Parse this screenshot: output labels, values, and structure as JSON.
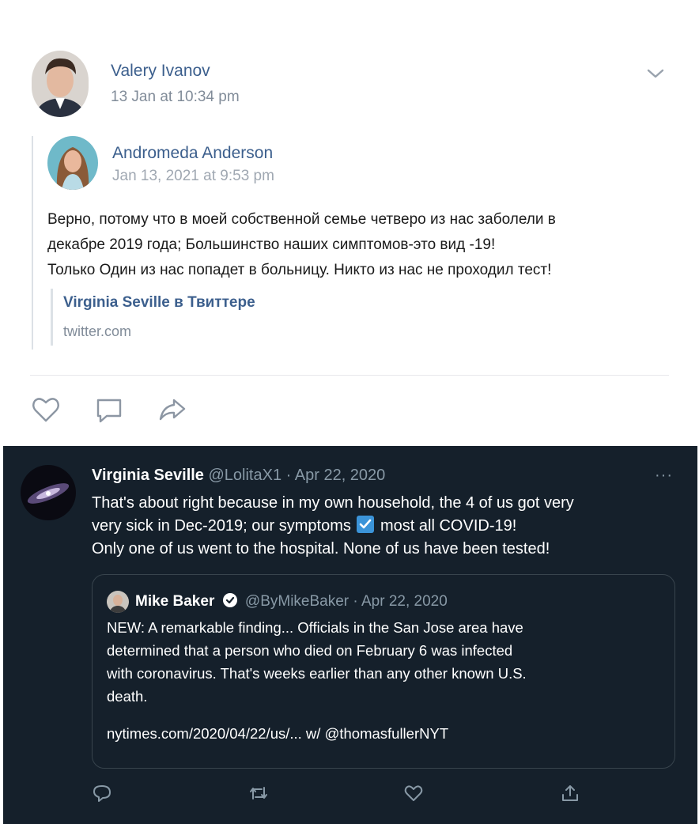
{
  "vk_post": {
    "author": "Valery Ivanov",
    "timestamp": "13 Jan at 10:34 pm",
    "quoted": {
      "author": "Andromeda Anderson",
      "timestamp": "Jan 13, 2021 at 9:53 pm",
      "lines": [
        "Верно, потому что в моей собственной семье четверо из нас заболели в",
        "декабре 2019 года; Большинство наших симптомов-это вид -19!",
        "Только Один из нас попадет в больницу. Никто из нас не проходил тест!"
      ],
      "link": {
        "title": "Virginia Seville в Твиттере",
        "domain": "twitter.com"
      }
    },
    "icons": [
      "chevron-down-icon",
      "heart-icon",
      "comment-icon",
      "share-icon"
    ]
  },
  "tweet": {
    "name": "Virginia Seville",
    "handle": "@LolitaX1",
    "separator": "·",
    "date": "Apr 22, 2020",
    "more": "···",
    "line1": "That's about right because in my own household, the 4 of us got very",
    "line2_before": "very sick in Dec-2019; our symptoms",
    "line2_after": "most all COVID-19!",
    "line3": "Only one of us went to the hospital. None of us have been tested!",
    "quoted_tweet": {
      "name": "Mike Baker",
      "handle": "@ByMikeBaker",
      "separator": "·",
      "date": "Apr 22, 2020",
      "lines": [
        "NEW: A remarkable finding... Officials in the San Jose area have",
        "determined that a person who died on February 6 was infected",
        "with coronavirus. That's weeks earlier than any other known U.S.",
        "death."
      ],
      "link": "nytimes.com/2020/04/22/us/... w/ @thomasfullerNYT"
    },
    "icons": [
      "reply-icon",
      "retweet-icon",
      "like-icon",
      "upload-icon"
    ],
    "colors": {
      "background": "#15202b",
      "muted": "#8899a6",
      "check": "#3b94d9"
    }
  }
}
